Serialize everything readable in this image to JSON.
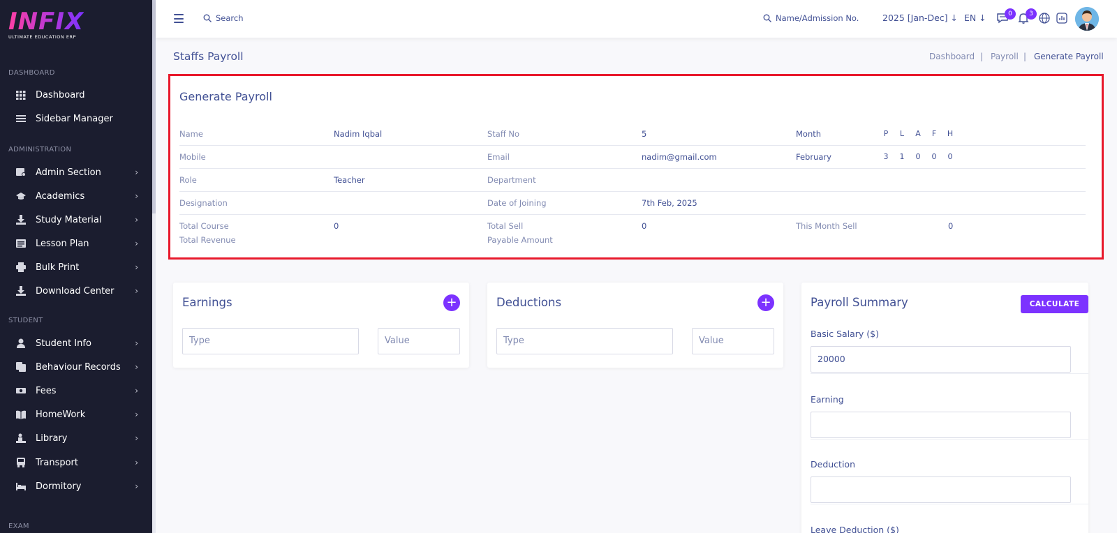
{
  "brand": {
    "logo": "INFIX",
    "tagline": "ULTIMATE EDUCATION ERP"
  },
  "sidebar": {
    "sections": [
      "DASHBOARD",
      "ADMINISTRATION",
      "STUDENT",
      "EXAM"
    ],
    "items": [
      {
        "label": "Dashboard",
        "icon": "grid-icon"
      },
      {
        "label": "Sidebar Manager",
        "icon": "list-icon"
      },
      {
        "label": "Admin Section",
        "icon": "admin-icon"
      },
      {
        "label": "Academics",
        "icon": "graduation-cap-icon"
      },
      {
        "label": "Study Material",
        "icon": "download-icon"
      },
      {
        "label": "Lesson Plan",
        "icon": "lesson-icon"
      },
      {
        "label": "Bulk Print",
        "icon": "printer-icon"
      },
      {
        "label": "Download Center",
        "icon": "download-icon"
      },
      {
        "label": "Student Info",
        "icon": "user-icon"
      },
      {
        "label": "Behaviour Records",
        "icon": "records-icon"
      },
      {
        "label": "Fees",
        "icon": "money-icon"
      },
      {
        "label": "HomeWork",
        "icon": "book-icon"
      },
      {
        "label": "Library",
        "icon": "library-icon"
      },
      {
        "label": "Transport",
        "icon": "bus-icon"
      },
      {
        "label": "Dormitory",
        "icon": "bed-icon"
      }
    ]
  },
  "topbar": {
    "search_label": "Search",
    "student_search_label": "Name/Admission No.",
    "session": "2025 [Jan-Dec]",
    "language": "EN",
    "messages_badge": "0",
    "notifications_badge": "3"
  },
  "page": {
    "title": "Staffs Payroll",
    "breadcrumb": [
      "Dashboard",
      "Payroll",
      "Generate Payroll"
    ],
    "separator": "|"
  },
  "generate": {
    "title": "Generate Payroll",
    "labels": {
      "name": "Name",
      "staff_no": "Staff No",
      "month": "Month",
      "mobile": "Mobile",
      "email": "Email",
      "role": "Role",
      "department": "Department",
      "designation": "Designation",
      "doj": "Date of Joining",
      "total_course": "Total Course",
      "total_sell": "Total Sell",
      "this_month_sell": "This Month Sell",
      "total_revenue": "Total Revenue",
      "payable_amount": "Payable Amount"
    },
    "values": {
      "name": "Nadim Iqbal",
      "staff_no": "5",
      "month": "February",
      "mobile": "",
      "email": "nadim@gmail.com",
      "role": "Teacher",
      "department": "",
      "designation": "",
      "doj": "7th Feb, 2025",
      "total_course": "0",
      "total_sell": "0",
      "this_month_sell": "0"
    },
    "attendance_headers": [
      "P",
      "L",
      "A",
      "F",
      "H"
    ],
    "attendance_values": [
      "3",
      "1",
      "0",
      "0",
      "0"
    ]
  },
  "earnings": {
    "title": "Earnings",
    "type_placeholder": "Type",
    "value_placeholder": "Value",
    "add": "+"
  },
  "deductions": {
    "title": "Deductions",
    "type_placeholder": "Type",
    "value_placeholder": "Value",
    "add": "+"
  },
  "summary": {
    "title": "Payroll Summary",
    "calculate": "CALCULATE",
    "basic_salary_label": "Basic Salary ($)",
    "basic_salary": "20000",
    "earning_label": "Earning",
    "earning": "",
    "deduction_label": "Deduction",
    "deduction": "",
    "leave_deduction_label": "Leave Deduction ($)"
  },
  "colors": {
    "accent": "#7c32ff",
    "text": "#415094",
    "muted": "#828bb2",
    "highlight": "#e8192c",
    "sidebar": "#1b1d2f"
  }
}
